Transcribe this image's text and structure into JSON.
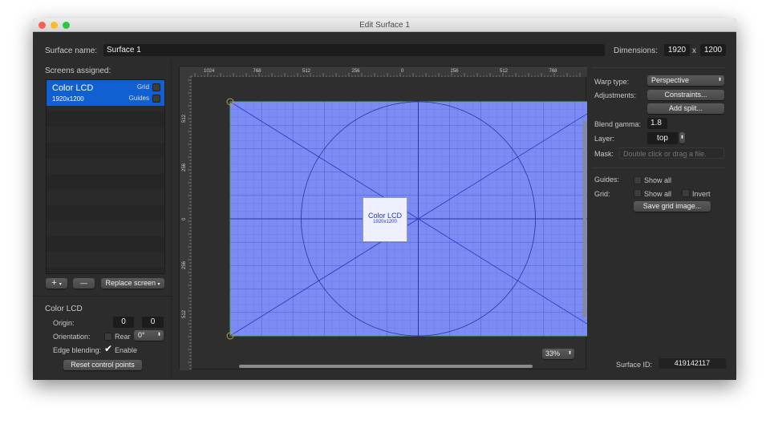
{
  "window": {
    "title": "Edit Surface 1"
  },
  "surface": {
    "name_label": "Surface name:",
    "name_value": "Surface 1",
    "dimensions_label": "Dimensions:",
    "width": "1920",
    "x": "x",
    "height": "1200"
  },
  "screens": {
    "label": "Screens assigned:",
    "items": [
      {
        "name": "Color LCD",
        "resolution": "1920x1200",
        "grid_label": "Grid",
        "guides_label": "Guides",
        "grid_checked": false,
        "guides_checked": false
      }
    ],
    "add_label": "+",
    "remove_label": "—",
    "replace_label": "Replace screen"
  },
  "screen_settings": {
    "title": "Color LCD",
    "origin_label": "Origin:",
    "origin_x": "0",
    "origin_y": "0",
    "orientation_label": "Orientation:",
    "rear_label": "Rear",
    "rear_checked": false,
    "rotation": "0°",
    "edge_label": "Edge blending:",
    "enable_label": "Enable",
    "enable_checked": true,
    "reset_label": "Reset control points"
  },
  "canvas": {
    "ruler_top": [
      "1024",
      "768",
      "512",
      "256",
      "0",
      "256",
      "512",
      "768"
    ],
    "ruler_left": [
      "512",
      "256",
      "0",
      "256",
      "512"
    ],
    "screen_name": "Color LCD",
    "screen_res": "1920x1200",
    "zoom": "33%",
    "surface_color": "#7b8cf5"
  },
  "right": {
    "warp_label": "Warp type:",
    "warp_value": "Perspective",
    "adjust_label": "Adjustments:",
    "constraints": "Constraints...",
    "add_split": "Add split...",
    "gamma_label": "Blend gamma:",
    "gamma": "1.8",
    "layer_label": "Layer:",
    "layer": "top",
    "mask_label": "Mask:",
    "mask_placeholder": "Double click or drag a file.",
    "guides_label": "Guides:",
    "guides_show": "Show all",
    "grid_label": "Grid:",
    "grid_show": "Show all",
    "invert": "Invert",
    "save_grid": "Save grid image...",
    "surface_id_label": "Surface ID:",
    "surface_id": "419142117"
  }
}
